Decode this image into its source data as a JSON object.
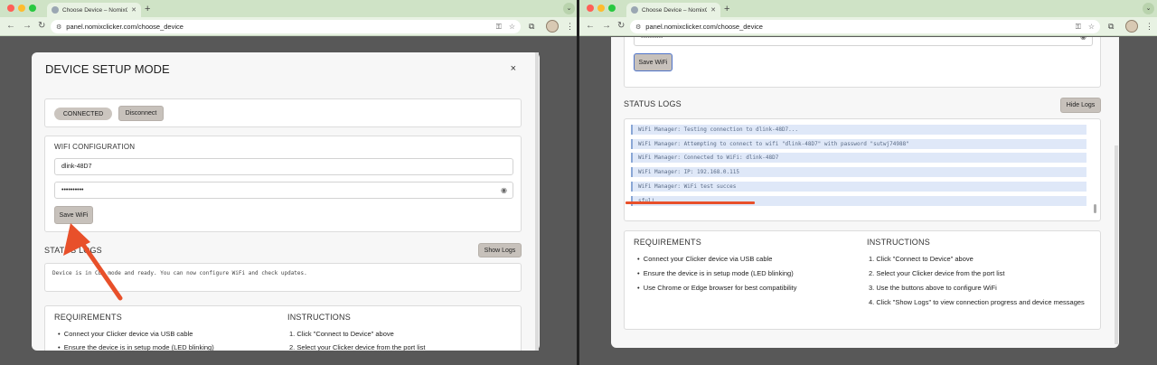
{
  "browser": {
    "tab_title": "Choose Device – NomixClicker",
    "new_tab_symbol": "+",
    "url": "panel.nomixclicker.com/choose_device"
  },
  "left": {
    "modal_title": "DEVICE SETUP MODE",
    "close_symbol": "×",
    "connection": {
      "status": "CONNECTED",
      "disconnect_label": "Disconnect"
    },
    "wifi": {
      "title": "WIFI CONFIGURATION",
      "ssid_value": "dlink-48D7",
      "password_value": "••••••••••",
      "save_label": "Save WiFi"
    },
    "status_logs": {
      "title": "STATUS LOGS",
      "button_label": "Show Logs",
      "message": "Device is in CLI mode and ready. You can now configure WiFi and check updates."
    },
    "requirements": {
      "title": "REQUIREMENTS",
      "items": [
        "Connect your Clicker device via USB cable",
        "Ensure the device is in setup mode (LED blinking)"
      ]
    },
    "instructions": {
      "title": "INSTRUCTIONS",
      "items": [
        "1. Click \"Connect to Device\" above",
        "2. Select your Clicker device from the port list"
      ]
    }
  },
  "right": {
    "password_value": "••••••••••",
    "save_label": "Save WiFi",
    "status_logs": {
      "title": "STATUS LOGS",
      "button_label": "Hide Logs",
      "lines": [
        "WiFi Manager: Testing connection to dlink-48D7...",
        "WiFi Manager: Attempting to connect to wifi \"dlink-48D7\" with password \"sutwj74988\"",
        "WiFi Manager: Connected to WiFi: dlink-48D7",
        "WiFi Manager: IP: 192.168.0.115",
        "WiFi Manager: WiFi test succes",
        "sful!"
      ]
    },
    "requirements": {
      "title": "REQUIREMENTS",
      "items": [
        "Connect your Clicker device via USB cable",
        "Ensure the device is in setup mode (LED blinking)",
        "Use Chrome or Edge browser for best compatibility"
      ]
    },
    "instructions": {
      "title": "INSTRUCTIONS",
      "items": [
        "1. Click \"Connect to Device\" above",
        "2. Select your Clicker device from the port list",
        "3. Use the buttons above to configure WiFi",
        "4. Click \"Show Logs\" to view connection progress and device messages"
      ]
    }
  },
  "colors": {
    "tab_strip": "#cfe3c6",
    "annotation": "#e8502a",
    "log_highlight": "#dfe8f8",
    "button_gray": "#c7c1bb"
  },
  "icons": {
    "back": "back-arrow-icon",
    "forward": "forward-arrow-icon",
    "reload": "reload-icon",
    "site_info": "site-info-icon",
    "bookmark": "star-icon",
    "extensions": "puzzle-icon",
    "eye": "eye-icon",
    "menu": "kebab-menu-icon"
  }
}
